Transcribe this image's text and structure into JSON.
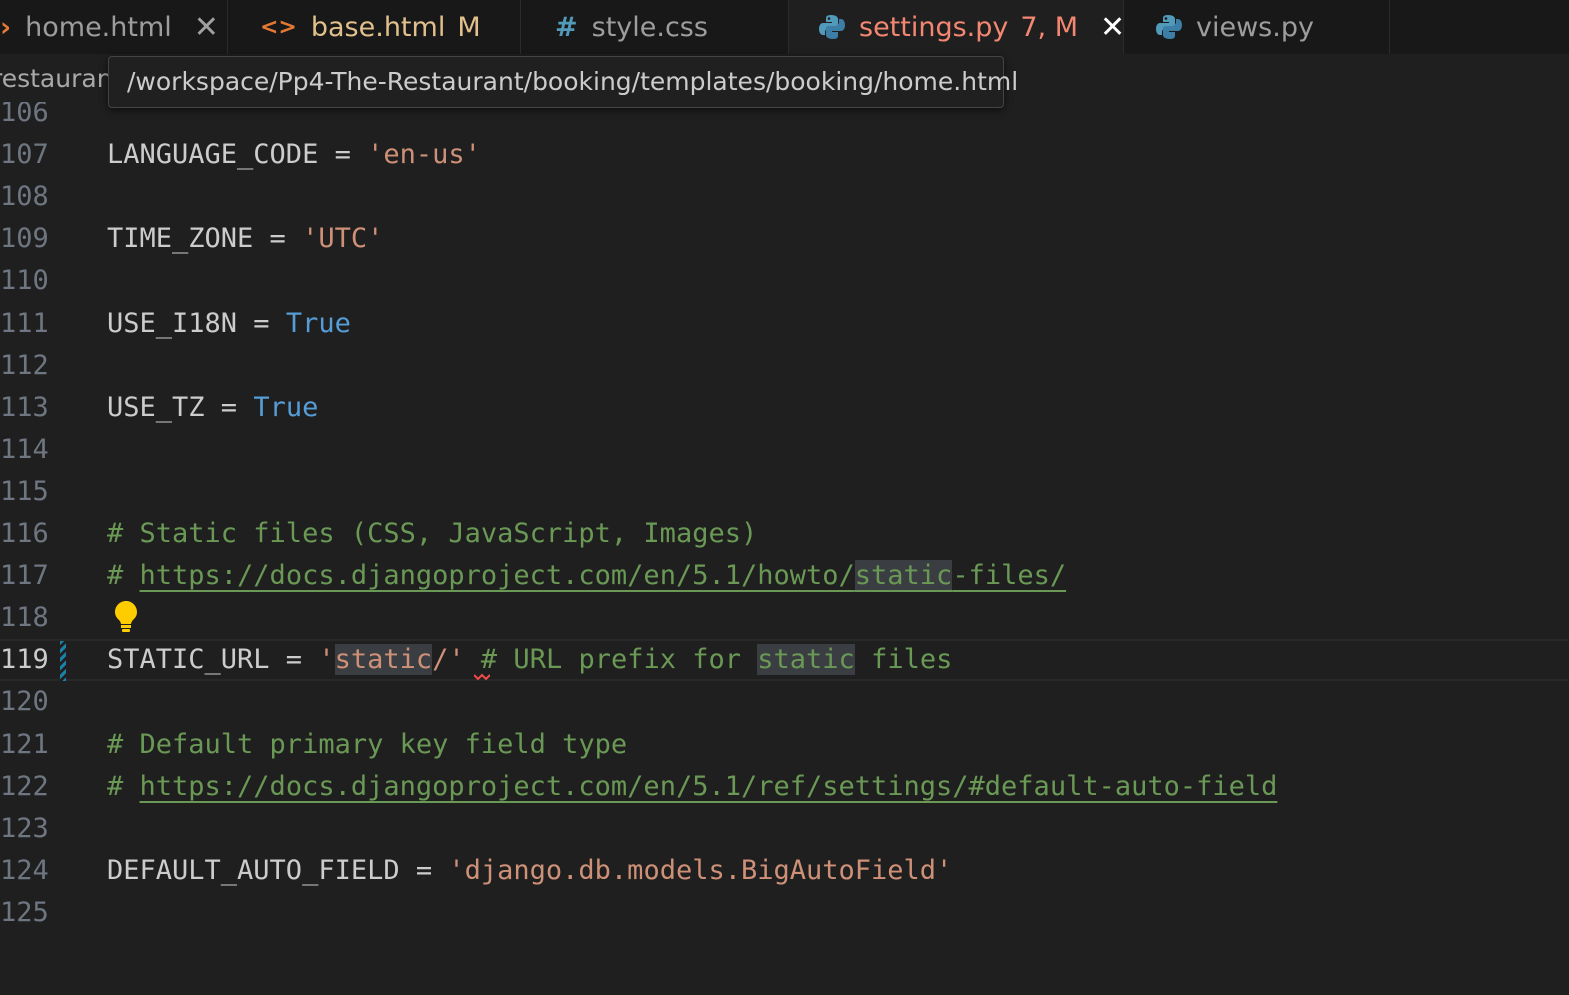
{
  "tabs": [
    {
      "prefix_icon": "chevron-icon",
      "name": "home.html",
      "badge": "",
      "close": "✕",
      "active": false
    },
    {
      "prefix_icon": "html-icon",
      "name": "base.html",
      "badge": "M",
      "close": "",
      "active": false
    },
    {
      "prefix_icon": "hash-icon",
      "name": "style.css",
      "badge": "",
      "close": "",
      "active": false
    },
    {
      "prefix_icon": "python-icon",
      "name": "settings.py",
      "badge": "7, M",
      "close": "✕",
      "active": true
    },
    {
      "prefix_icon": "python-icon",
      "name": "views.py",
      "badge": "",
      "close": "",
      "active": false
    }
  ],
  "breadcrumb": {
    "text": "restaurant"
  },
  "tooltip": {
    "text": "/workspace/Pp4-The-Restaurant/booking/templates/booking/home.html"
  },
  "icons": {
    "tab_chevron": "›",
    "tab_html": "<>",
    "tab_hash": "#"
  },
  "colors": {
    "string": "#ce9178",
    "keyword": "#569cd6",
    "comment": "#6a9955",
    "error_tab": "#f48771",
    "modified": "#e2c08d",
    "background": "#1f1f1f"
  },
  "editor": {
    "current_line": "119",
    "lines": [
      {
        "num": "106",
        "parts": []
      },
      {
        "num": "107",
        "parts": [
          [
            "plain",
            "LANGUAGE_CODE = "
          ],
          [
            "str",
            "'en-us'"
          ]
        ]
      },
      {
        "num": "108",
        "parts": []
      },
      {
        "num": "109",
        "parts": [
          [
            "plain",
            "TIME_ZONE = "
          ],
          [
            "str",
            "'UTC'"
          ]
        ]
      },
      {
        "num": "110",
        "parts": []
      },
      {
        "num": "111",
        "parts": [
          [
            "plain",
            "USE_I18N = "
          ],
          [
            "kw",
            "True"
          ]
        ]
      },
      {
        "num": "112",
        "parts": []
      },
      {
        "num": "113",
        "parts": [
          [
            "plain",
            "USE_TZ = "
          ],
          [
            "kw",
            "True"
          ]
        ]
      },
      {
        "num": "114",
        "parts": []
      },
      {
        "num": "115",
        "parts": []
      },
      {
        "num": "116",
        "parts": [
          [
            "cm",
            "# Static files (CSS, JavaScript, Images)"
          ]
        ]
      },
      {
        "num": "117",
        "parts": [
          [
            "cm",
            "# "
          ],
          [
            "url",
            "https://docs.djangoproject.com/en/5.1/howto/"
          ],
          [
            "urlhl",
            "static"
          ],
          [
            "url",
            "-files/"
          ]
        ]
      },
      {
        "num": "118",
        "parts": []
      },
      {
        "num": "119",
        "parts": [
          [
            "plain",
            "STATIC_URL = "
          ],
          [
            "str",
            "'"
          ],
          [
            "strhl",
            "static"
          ],
          [
            "str",
            "/'"
          ],
          [
            "plain",
            " "
          ],
          [
            "cm",
            "# URL prefix for "
          ],
          [
            "cmhl",
            "static"
          ],
          [
            "cm",
            " files"
          ]
        ]
      },
      {
        "num": "120",
        "parts": []
      },
      {
        "num": "121",
        "parts": [
          [
            "cm",
            "# Default primary key field type"
          ]
        ]
      },
      {
        "num": "122",
        "parts": [
          [
            "cm",
            "# "
          ],
          [
            "url",
            "https://docs.djangoproject.com/en/5.1/ref/settings/#default-auto-field"
          ]
        ]
      },
      {
        "num": "123",
        "parts": []
      },
      {
        "num": "124",
        "parts": [
          [
            "plain",
            "DEFAULT_AUTO_FIELD = "
          ],
          [
            "str",
            "'django.db.models.BigAutoField'"
          ]
        ]
      },
      {
        "num": "125",
        "parts": []
      }
    ]
  }
}
